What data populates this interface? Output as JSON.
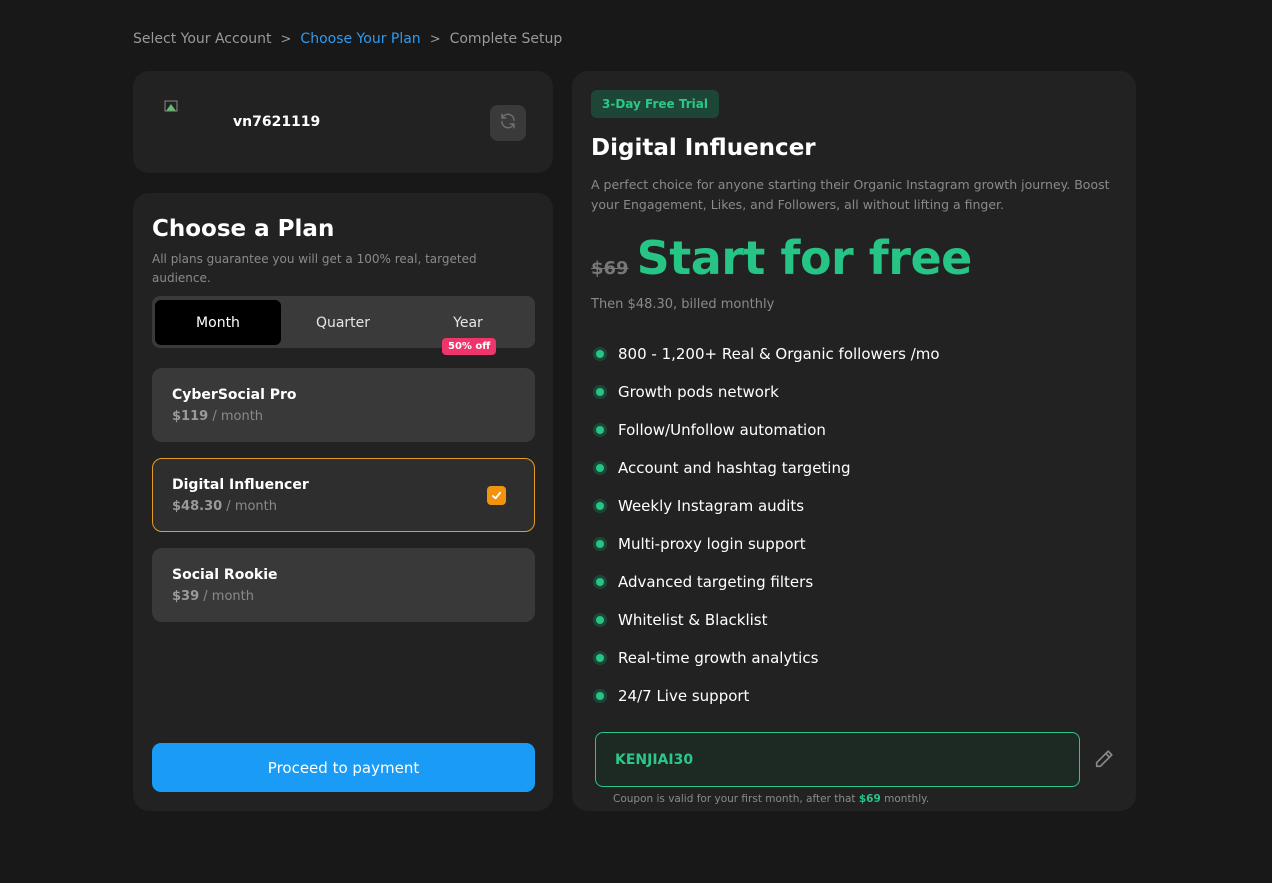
{
  "breadcrumb": {
    "step1": "Select Your Account",
    "step2": "Choose Your Plan",
    "step3": "Complete Setup",
    "separator": ">"
  },
  "account": {
    "username": "vn7621119",
    "refresh_icon": "refresh-icon"
  },
  "plans": {
    "title": "Choose a Plan",
    "subtitle": "All plans guarantee you will get a 100% real, targeted audience.",
    "periods": {
      "month": "Month",
      "quarter": "Quarter",
      "year": "Year",
      "selected": "Month",
      "year_badge": "50% off"
    },
    "options": [
      {
        "name": "CyberSocial Pro",
        "price": "$119",
        "period": " / month",
        "selected": false
      },
      {
        "name": "Digital Influencer",
        "price": "$48.30",
        "period": " / month",
        "selected": true
      },
      {
        "name": "Social Rookie",
        "price": "$39",
        "period": " / month",
        "selected": false
      }
    ],
    "proceed_label": "Proceed to payment"
  },
  "detail": {
    "trial_badge": "3-Day Free Trial",
    "title": "Digital Influencer",
    "description": "A perfect choice for anyone starting their Organic Instagram growth journey. Boost your Engagement, Likes, and Followers, all without lifting a finger.",
    "old_price": "$69",
    "headline": "Start for free",
    "then_text": "Then $48.30, billed monthly",
    "features": [
      "800 - 1,200+ Real & Organic followers /mo",
      "Growth pods network",
      "Follow/Unfollow automation",
      "Account and hashtag targeting",
      "Weekly Instagram audits",
      "Multi-proxy login support",
      "Advanced targeting filters",
      "Whitelist & Blacklist",
      "Real-time growth analytics",
      "24/7 Live support"
    ],
    "coupon": {
      "value": "KENJIAI30",
      "note_prefix": "Coupon is valid for your first month, after that ",
      "note_amount": "$69",
      "note_suffix": " monthly."
    }
  },
  "colors": {
    "accent_blue": "#1a9bf5",
    "accent_green": "#26c485",
    "selected_border": "#e79a22",
    "badge_pink": "#f0356a"
  }
}
